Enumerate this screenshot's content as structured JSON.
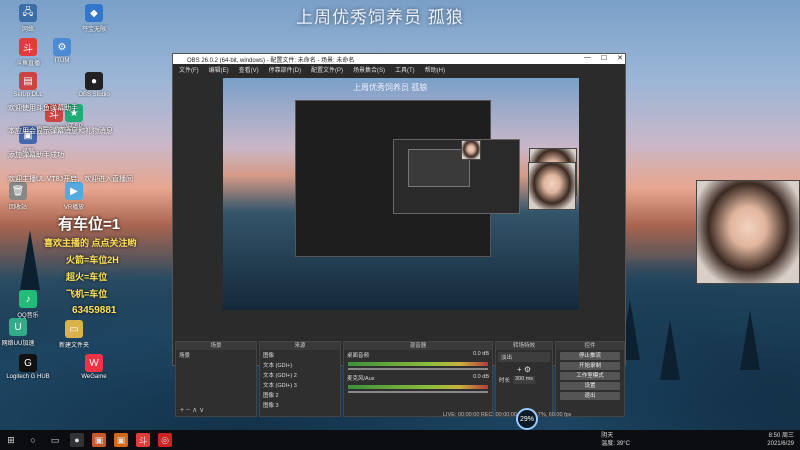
{
  "stream_title": "上周优秀饲养员 孤狼",
  "desktop_icons": [
    {
      "label": "网络",
      "glyph": "🖧",
      "color": "#3a6ea5"
    },
    {
      "label": "夺宝无限",
      "glyph": "◆",
      "color": "#3377cc"
    },
    {
      "label": "斗鱼直播",
      "glyph": "斗",
      "color": "#e23b3b"
    },
    {
      "label": "ITUM",
      "glyph": "⚙",
      "color": "#4c8ad3"
    },
    {
      "label": "SetUp DLL",
      "glyph": "▤",
      "color": "#c44"
    },
    {
      "label": "OBS Studio",
      "glyph": "●",
      "color": "#222"
    },
    {
      "label": "欢迎使用斗鱼弹幕助手",
      "glyph": "斗",
      "color": "#c44"
    },
    {
      "label": "VT SP",
      "glyph": "★",
      "color": "#2a7"
    },
    {
      "label": "录屏",
      "glyph": "▣",
      "color": "#46a"
    },
    {
      "label": "回收站",
      "glyph": "🗑",
      "color": "#888"
    },
    {
      "label": "VR播放",
      "glyph": "▶",
      "color": "#5ad"
    },
    {
      "label": "QQ音乐",
      "glyph": "♪",
      "color": "#2b7"
    },
    {
      "label": "新建文件夹",
      "glyph": "▭",
      "color": "#d9b24a"
    },
    {
      "label": "网络UU加速",
      "glyph": "U",
      "color": "#3a8"
    },
    {
      "label": "Logitech G HUB",
      "glyph": "G",
      "color": "#111"
    },
    {
      "label": "WeGame",
      "glyph": "W",
      "color": "#e34"
    }
  ],
  "desktop_notes": [
    "欢迎使用斗鱼弹幕助手",
    "本应用会显示弹幕消息和礼物消息",
    "添加弹幕助手成功",
    "欢迎主播UL VT8J开启，欢迎进入直播间"
  ],
  "overlay": {
    "title": "有车位=1",
    "lines": [
      "喜欢主播的 点点关注哟",
      "火箭=车位2H",
      "超火=车位",
      "飞机=车位"
    ],
    "qq": "63459881"
  },
  "obs": {
    "title": "OBS 26.0.2 (64-bit, windows) - 配置文件: 未命名 - 场景: 未命名",
    "menu": [
      "文件(F)",
      "编辑(E)",
      "查看(V)",
      "停靠部件(D)",
      "配置文件(P)",
      "场景集合(S)",
      "工具(T)",
      "帮助(H)"
    ],
    "preview_title": "上周优秀饲养员 孤狼",
    "panels": {
      "scenes": {
        "header": "场景",
        "items": [
          "场景"
        ]
      },
      "sources": {
        "header": "来源",
        "items": [
          "图像",
          "文本 (GDI+)",
          "文本 (GDI+) 2",
          "文本 (GDI+) 3",
          "图像 2",
          "图像 3"
        ]
      },
      "mixer": {
        "header": "混音器",
        "channels": [
          {
            "name": "桌面音频",
            "db": "0.0 dB"
          },
          {
            "name": "麦克风/Aux",
            "db": "0.0 dB"
          }
        ]
      },
      "transitions": {
        "header": "转场特效",
        "type": "淡出",
        "duration_label": "时长",
        "duration": "300 ms"
      },
      "controls": {
        "header": "控件",
        "buttons": [
          "停止推流",
          "开始录制",
          "工作室模式",
          "设置",
          "退出"
        ]
      }
    },
    "status": "LIVE: 00:00:00   REC: 00:00:00   CPU: 2.7%, 60.00 fps"
  },
  "perf_badge": "29%",
  "taskbar": {
    "weather": "阴天",
    "weather_sub": "温度: 39°C",
    "time": "8:50 周三",
    "date": "2021/6/29"
  },
  "accent_color": "#4a6b8f"
}
